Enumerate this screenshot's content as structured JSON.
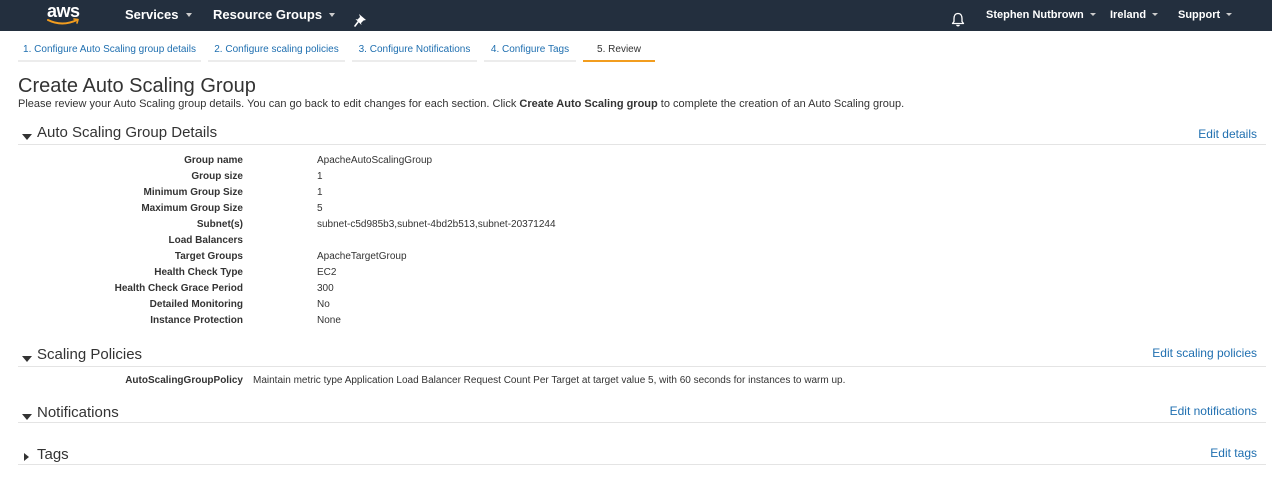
{
  "topnav": {
    "logo_text": "aws",
    "services_label": "Services",
    "resource_groups_label": "Resource Groups",
    "user_label": "Stephen Nutbrown",
    "region_label": "Ireland",
    "support_label": "Support",
    "colors": {
      "background": "#232f3e",
      "logo_smile": "#f29d1f"
    },
    "icons": [
      "pin-icon",
      "bell-icon"
    ]
  },
  "wizard": {
    "steps": [
      "1. Configure Auto Scaling group details",
      "2. Configure scaling policies",
      "3. Configure Notifications",
      "4. Configure Tags",
      "5. Review"
    ],
    "active_step": 4,
    "colors": {
      "active_underline": "#f29d1f",
      "link": "#1f6fb0"
    }
  },
  "page": {
    "title": "Create Auto Scaling Group",
    "intro_before": "Please review your Auto Scaling group details. You can go back to edit changes for each section. Click ",
    "intro_bold": "Create Auto Scaling group",
    "intro_after": " to complete the creation of an Auto Scaling group."
  },
  "sections": {
    "details": {
      "title": "Auto Scaling Group Details",
      "edit_label": "Edit details",
      "rows": [
        {
          "label": "Group name",
          "value": "ApacheAutoScalingGroup"
        },
        {
          "label": "Group size",
          "value": "1"
        },
        {
          "label": "Minimum Group Size",
          "value": "1"
        },
        {
          "label": "Maximum Group Size",
          "value": "5"
        },
        {
          "label": "Subnet(s)",
          "value": "subnet-c5d985b3,subnet-4bd2b513,subnet-20371244"
        },
        {
          "label": "Load Balancers",
          "value": ""
        },
        {
          "label": "Target Groups",
          "value": "ApacheTargetGroup"
        },
        {
          "label": "Health Check Type",
          "value": "EC2"
        },
        {
          "label": "Health Check Grace Period",
          "value": "300"
        },
        {
          "label": "Detailed Monitoring",
          "value": "No"
        },
        {
          "label": "Instance Protection",
          "value": "None"
        }
      ]
    },
    "scaling": {
      "title": "Scaling Policies",
      "edit_label": "Edit scaling policies",
      "policy_label": "AutoScalingGroupPolicy",
      "policy_value": "Maintain metric type Application Load Balancer Request Count Per Target at target value 5, with 60 seconds for instances to warm up."
    },
    "notifications": {
      "title": "Notifications",
      "edit_label": "Edit notifications"
    },
    "tags": {
      "title": "Tags",
      "edit_label": "Edit tags"
    }
  }
}
